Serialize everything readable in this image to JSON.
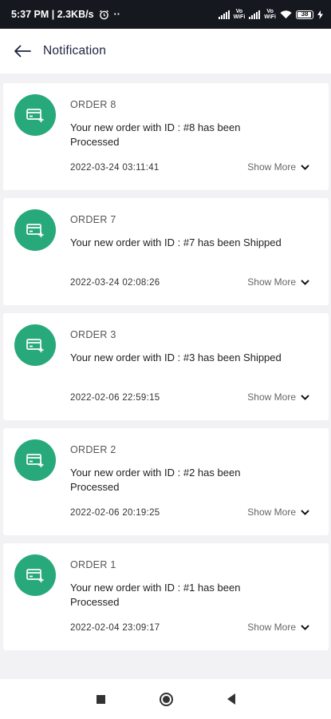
{
  "status_bar": {
    "time_speed": "5:37 PM | 2.3KB/s",
    "dots": "··",
    "volte_1_top": "Vo",
    "volte_1_bottom": "WiFi",
    "volte_2_top": "Vo",
    "volte_2_bottom": "WiFi",
    "battery": "38"
  },
  "header": {
    "title": "Notification"
  },
  "notifications": [
    {
      "title": "ORDER 8",
      "message": "Your new order with ID : #8  has been Processed",
      "datetime": "2022-03-24 03:11:41",
      "action": "Show More"
    },
    {
      "title": "ORDER 7",
      "message": "Your new order with ID : #7  has been Shipped",
      "datetime": "2022-03-24 02:08:26",
      "action": "Show More"
    },
    {
      "title": "ORDER 3",
      "message": "Your new order with ID : #3  has been Shipped",
      "datetime": "2022-02-06 22:59:15",
      "action": "Show More"
    },
    {
      "title": "ORDER 2",
      "message": "Your new order with ID : #2  has been Processed",
      "datetime": "2022-02-06 20:19:25",
      "action": "Show More"
    },
    {
      "title": "ORDER 1",
      "message": "Your new order with ID : #1  has been Processed",
      "datetime": "2022-02-04 23:09:17",
      "action": "Show More"
    }
  ],
  "colors": {
    "accent": "#28a97b",
    "status_bar_bg": "#15181f",
    "page_bg": "#f2f2f4"
  },
  "icons": {
    "back": "arrow-left-icon",
    "notification": "credit-card-plus-icon",
    "expand": "chevron-down-icon"
  }
}
